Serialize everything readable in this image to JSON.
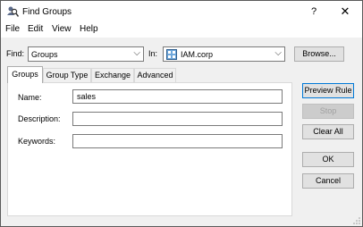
{
  "window": {
    "title": "Find Groups",
    "help_label": "?",
    "close_label": "✕"
  },
  "menu": [
    "File",
    "Edit",
    "View",
    "Help"
  ],
  "find": {
    "label": "Find:",
    "value": "Groups"
  },
  "in": {
    "label": "In:",
    "value": "IAM.corp"
  },
  "browse_button": "Browse...",
  "tabs": [
    "Groups",
    "Group Type",
    "Exchange",
    "Advanced"
  ],
  "form": {
    "name_label": "Name:",
    "name_value": "sales",
    "description_label": "Description:",
    "description_value": "",
    "keywords_label": "Keywords:",
    "keywords_value": ""
  },
  "buttons": {
    "preview_rule": "Preview Rule",
    "stop": "Stop",
    "clear_all": "Clear All",
    "ok": "OK",
    "cancel": "Cancel"
  },
  "icons": {
    "app": "find-groups-icon",
    "domain": "domain-icon",
    "help": "help-icon",
    "close": "close-icon",
    "dropdown": "chevron-down-icon"
  }
}
